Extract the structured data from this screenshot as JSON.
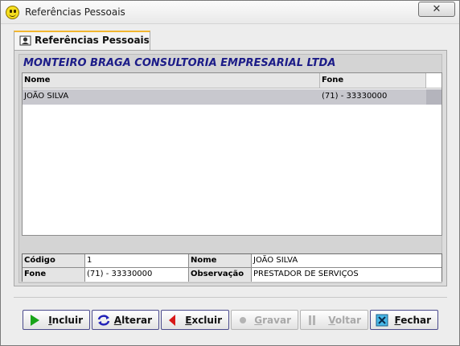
{
  "window": {
    "title": "Referências Pessoais",
    "close_symbol": "✕"
  },
  "tab": {
    "label": "Referências Pessoais",
    "icon": "user-card-icon"
  },
  "company_name": "MONTEIRO BRAGA CONSULTORIA EMPRESARIAL LTDA",
  "grid": {
    "columns": [
      "Nome",
      "Fone"
    ],
    "rows": [
      {
        "nome": "JOÃO SILVA",
        "fone": "(71) - 33330000"
      }
    ]
  },
  "form": {
    "codigo_label": "Código",
    "codigo_value": "1",
    "nome_label": "Nome",
    "nome_value": "JOÃO SILVA",
    "fone_label": "Fone",
    "fone_value": "(71) - 33330000",
    "obs_label": "Observação",
    "obs_value": "PRESTADOR DE SERVIÇOS"
  },
  "buttons": {
    "incluir": "Incluir",
    "alterar": "Alterar",
    "excluir": "Excluir",
    "gravar": "Gravar",
    "voltar": "Voltar",
    "fechar": "Fechar"
  },
  "colors": {
    "company_text": "#1c1c88",
    "selected_row": "#c8c8ce",
    "tab_accent": "#f2b630"
  }
}
